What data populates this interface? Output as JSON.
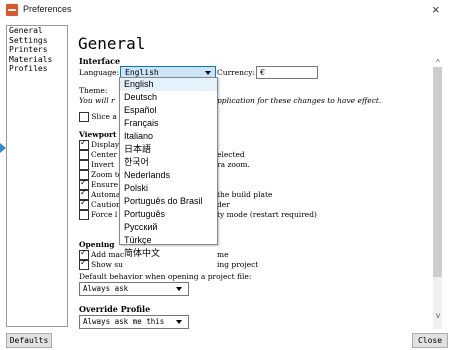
{
  "window": {
    "title": "Preferences",
    "close": "×"
  },
  "sidebar": {
    "items": [
      "General",
      "Settings",
      "Printers",
      "Materials",
      "Profiles"
    ]
  },
  "page": {
    "heading": "General"
  },
  "interface": {
    "section": "Interface",
    "language_label": "Language:",
    "language_value": "English",
    "currency_label": "Currency:",
    "currency_value": "€",
    "theme_label": "Theme:",
    "restart_note_a": "You will r",
    "restart_note_b": "pplication for these changes to have effect.",
    "slice_label": "Slice a"
  },
  "language_options": [
    "English",
    "Deutsch",
    "Español",
    "Français",
    "Italiano",
    "日本語",
    "한국어",
    "Nederlands",
    "Polski",
    "Português do Brasil",
    "Português",
    "Русский",
    "Türkçe",
    "简体中文"
  ],
  "viewport": {
    "section": "Viewport",
    "items": [
      {
        "a": "Display",
        "b": "",
        "on": true
      },
      {
        "a": "Center",
        "b": "elected",
        "on": false
      },
      {
        "a": "Invert",
        "b": "ra zoom.",
        "on": false
      },
      {
        "a": "Zoom to",
        "b": "",
        "on": false
      },
      {
        "a": "Ensure",
        "b": "",
        "on": true
      },
      {
        "a": "Automat",
        "b": " the build plate",
        "on": true
      },
      {
        "a": "Caution",
        "b": "der",
        "on": true
      },
      {
        "a": "Force l",
        "b": "ty mode (restart required)",
        "on": false
      }
    ]
  },
  "opening": {
    "section": "Opening",
    "items": [
      {
        "a": "Add mac",
        "b": "me",
        "on": true
      },
      {
        "a": "Show su",
        "b": "ing project",
        "on": true
      }
    ],
    "default_behavior_a": "Default behavior when opening",
    "default_behavior_b": " a project file:",
    "default_value": "Always ask"
  },
  "override": {
    "section": "Override Profile",
    "value": "Always ask me this"
  },
  "footer": {
    "defaults": "Defaults",
    "close": "Close"
  },
  "colors": {
    "accent": "#0078d7",
    "icon": "#e5532a",
    "arrow": "#2e8bd9"
  }
}
